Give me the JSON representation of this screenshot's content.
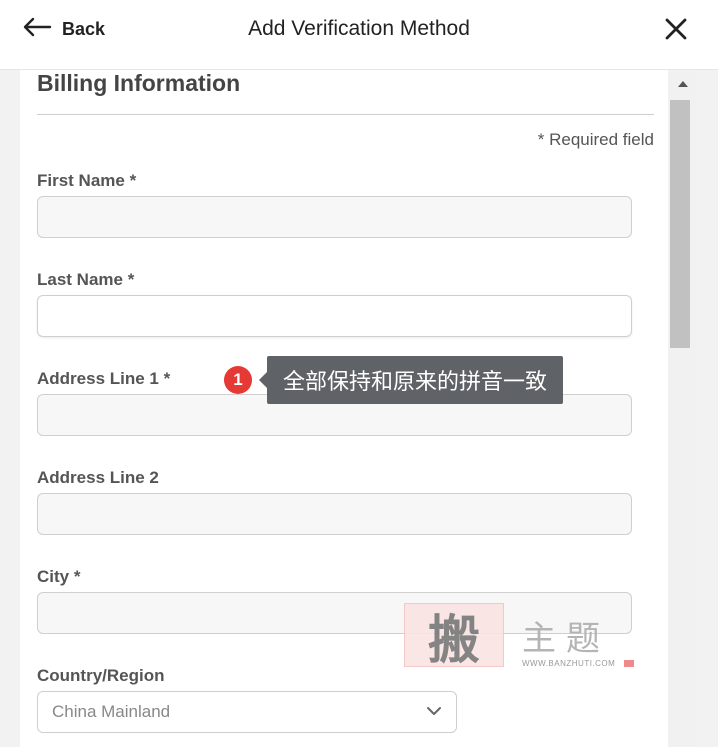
{
  "header": {
    "back_label": "Back",
    "title": "Add Verification Method"
  },
  "form": {
    "section_title": "Billing Information",
    "required_note": "* Required field",
    "fields": [
      {
        "label": "First Name *",
        "value": ""
      },
      {
        "label": "Last Name *",
        "value": ""
      },
      {
        "label": "Address Line 1 *",
        "value": ""
      },
      {
        "label": "Address Line 2",
        "value": ""
      },
      {
        "label": "City *",
        "value": ""
      }
    ],
    "country": {
      "label": "Country/Region",
      "selected": "China Mainland"
    }
  },
  "annotation": {
    "number": "1",
    "text": "全部保持和原来的拼音一致"
  },
  "watermark": {
    "seal": "搬",
    "text": "主题",
    "url": "WWW.BANZHUTI.COM"
  },
  "colors": {
    "badge": "#e53935",
    "tooltip": "#5f6368",
    "input_bg": "#f7f7f7"
  },
  "icons": {
    "back": "arrow-left-icon",
    "close": "close-icon",
    "select": "chevron-down-icon",
    "scroll": "triangle-up-icon"
  }
}
